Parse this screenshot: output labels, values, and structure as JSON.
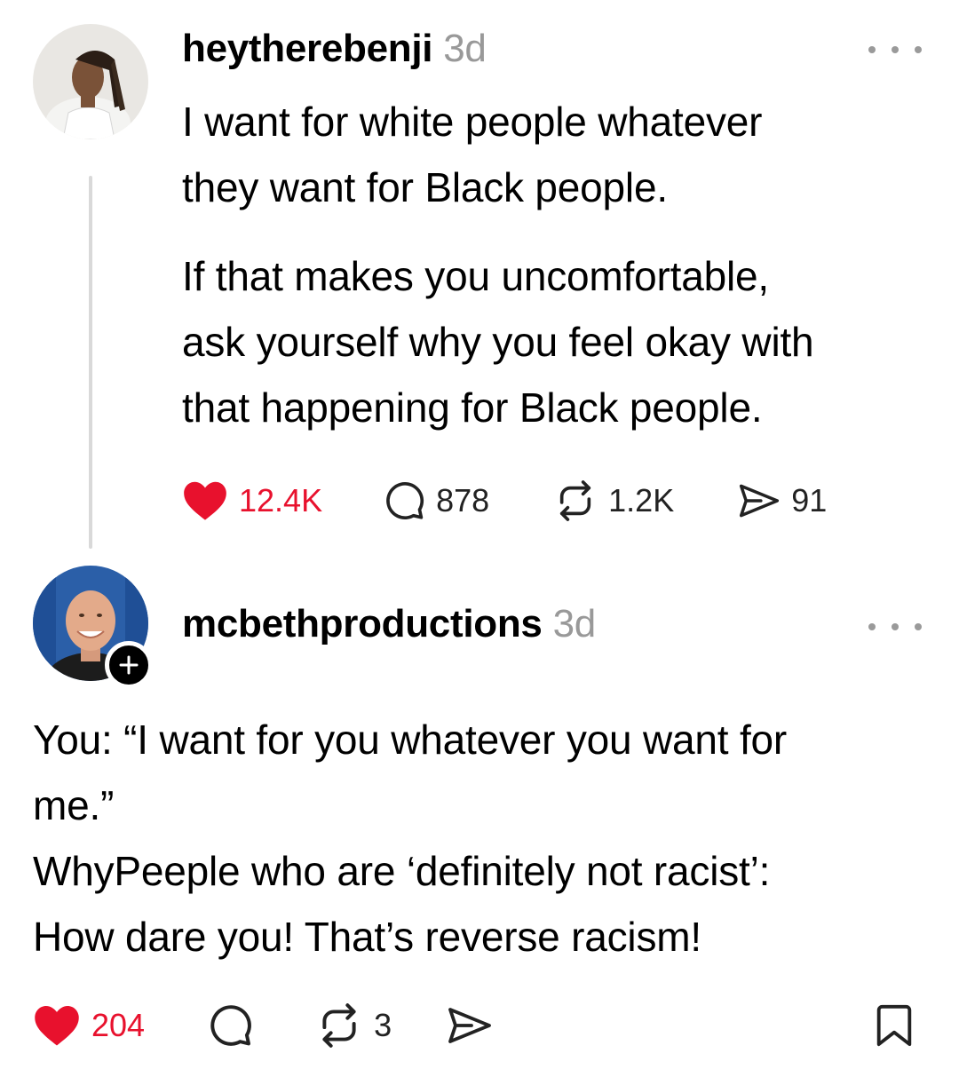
{
  "post": {
    "username": "heytherebenji",
    "time": "3d",
    "paragraph1_line1": "I want for white people whatever",
    "paragraph1_line2": "they want for Black people.",
    "paragraph2_line1": "If that makes you uncomfortable,",
    "paragraph2_line2": "ask yourself why you feel okay with",
    "paragraph2_line3": "that happening for Black people.",
    "likes": "12.4K",
    "replies": "878",
    "reposts": "1.2K",
    "shares": "91"
  },
  "reply": {
    "username": "mcbethproductions",
    "time": "3d",
    "line1": "You: “I want for you whatever you want for",
    "line2": "me.”",
    "line3": "WhyPeeple who are ‘definitely not racist’:",
    "line4": "How dare you! That’s reverse racism!",
    "likes": "204",
    "reposts": "3"
  },
  "colors": {
    "like_heart": "#e8112d",
    "secondary_text": "#999999",
    "thread_line": "#d9d9d9"
  },
  "icons": [
    "heart-icon",
    "comment-icon",
    "repost-icon",
    "share-icon",
    "bookmark-icon",
    "more-icon",
    "follow-plus-icon"
  ]
}
